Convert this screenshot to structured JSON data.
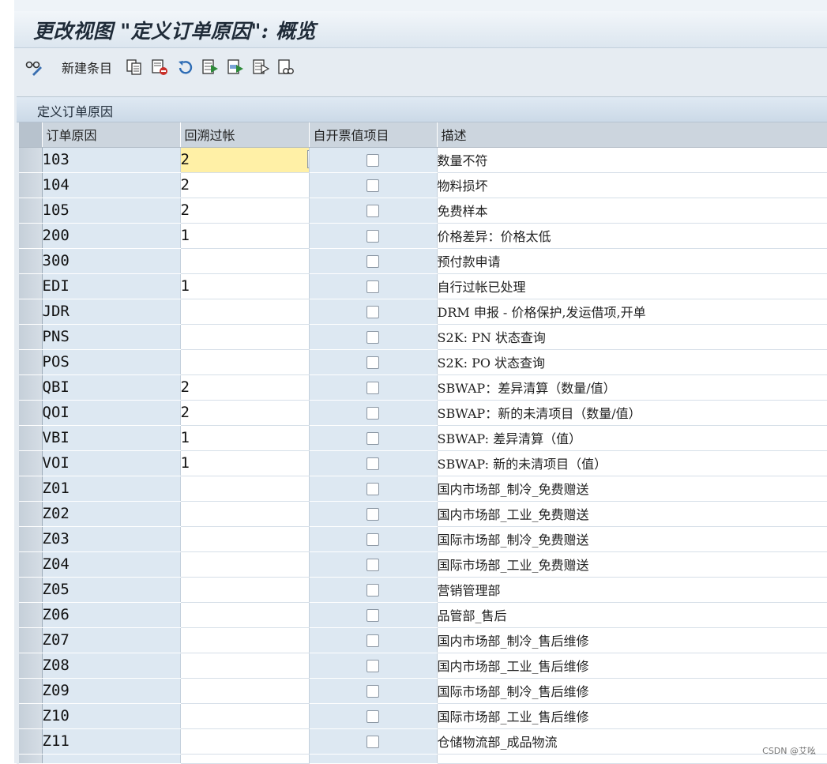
{
  "window": {
    "title": "更改视图 \"定义订单原因\": 概览"
  },
  "toolbar": {
    "items": [
      {
        "name": "glasses-change-icon",
        "label": ""
      },
      {
        "name": "new-entries-button",
        "label": "新建条目"
      },
      {
        "name": "copy-as-icon",
        "label": ""
      },
      {
        "name": "delete-icon",
        "label": ""
      },
      {
        "name": "undo-change-icon",
        "label": ""
      },
      {
        "name": "select-all-icon",
        "label": ""
      },
      {
        "name": "select-block-icon",
        "label": ""
      },
      {
        "name": "deselect-all-icon",
        "label": ""
      },
      {
        "name": "other-view-icon",
        "label": ""
      }
    ]
  },
  "section": {
    "title": "定义订单原因"
  },
  "table": {
    "headers": {
      "code": "订单原因",
      "period": "回溯过帐",
      "self_billing": "自开票值项目",
      "description": "描述"
    },
    "rows": [
      {
        "code": "103",
        "period": "2",
        "checked": false,
        "description": "数量不符"
      },
      {
        "code": "104",
        "period": "2",
        "checked": false,
        "description": "物料损坏"
      },
      {
        "code": "105",
        "period": "2",
        "checked": false,
        "description": "免费样本"
      },
      {
        "code": "200",
        "period": "1",
        "checked": false,
        "description": "价格差异：价格太低"
      },
      {
        "code": "300",
        "period": "",
        "checked": false,
        "description": "预付款申请"
      },
      {
        "code": "EDI",
        "period": "1",
        "checked": false,
        "description": "自行过帐已处理"
      },
      {
        "code": "JDR",
        "period": "",
        "checked": false,
        "description": "DRM 申报 - 价格保护,发运借项,开单"
      },
      {
        "code": "PNS",
        "period": "",
        "checked": false,
        "description": "S2K: PN 状态查询"
      },
      {
        "code": "POS",
        "period": "",
        "checked": false,
        "description": "S2K: PO 状态查询"
      },
      {
        "code": "QBI",
        "period": "2",
        "checked": false,
        "description": "SBWAP：差异清算（数量/值）"
      },
      {
        "code": "QOI",
        "period": "2",
        "checked": false,
        "description": "SBWAP：新的未清项目（数量/值）"
      },
      {
        "code": "VBI",
        "period": "1",
        "checked": false,
        "description": "SBWAP: 差异清算（值）"
      },
      {
        "code": "VOI",
        "period": "1",
        "checked": false,
        "description": "SBWAP: 新的未清项目（值）"
      },
      {
        "code": "Z01",
        "period": "",
        "checked": false,
        "description": "国内市场部_制冷_免费赠送"
      },
      {
        "code": "Z02",
        "period": "",
        "checked": false,
        "description": "国内市场部_工业_免费赠送"
      },
      {
        "code": "Z03",
        "period": "",
        "checked": false,
        "description": "国际市场部_制冷_免费赠送"
      },
      {
        "code": "Z04",
        "period": "",
        "checked": false,
        "description": "国际市场部_工业_免费赠送"
      },
      {
        "code": "Z05",
        "period": "",
        "checked": false,
        "description": "营销管理部"
      },
      {
        "code": "Z06",
        "period": "",
        "checked": false,
        "description": "品管部_售后"
      },
      {
        "code": "Z07",
        "period": "",
        "checked": false,
        "description": "国内市场部_制冷_售后维修"
      },
      {
        "code": "Z08",
        "period": "",
        "checked": false,
        "description": "国内市场部_工业_售后维修"
      },
      {
        "code": "Z09",
        "period": "",
        "checked": false,
        "description": "国际市场部_制冷_售后维修"
      },
      {
        "code": "Z10",
        "period": "",
        "checked": false,
        "description": "国际市场部_工业_售后维修"
      },
      {
        "code": "Z11",
        "period": "",
        "checked": false,
        "description": "仓储物流部_成品物流"
      }
    ]
  },
  "watermark": "CSDN @艾吆"
}
